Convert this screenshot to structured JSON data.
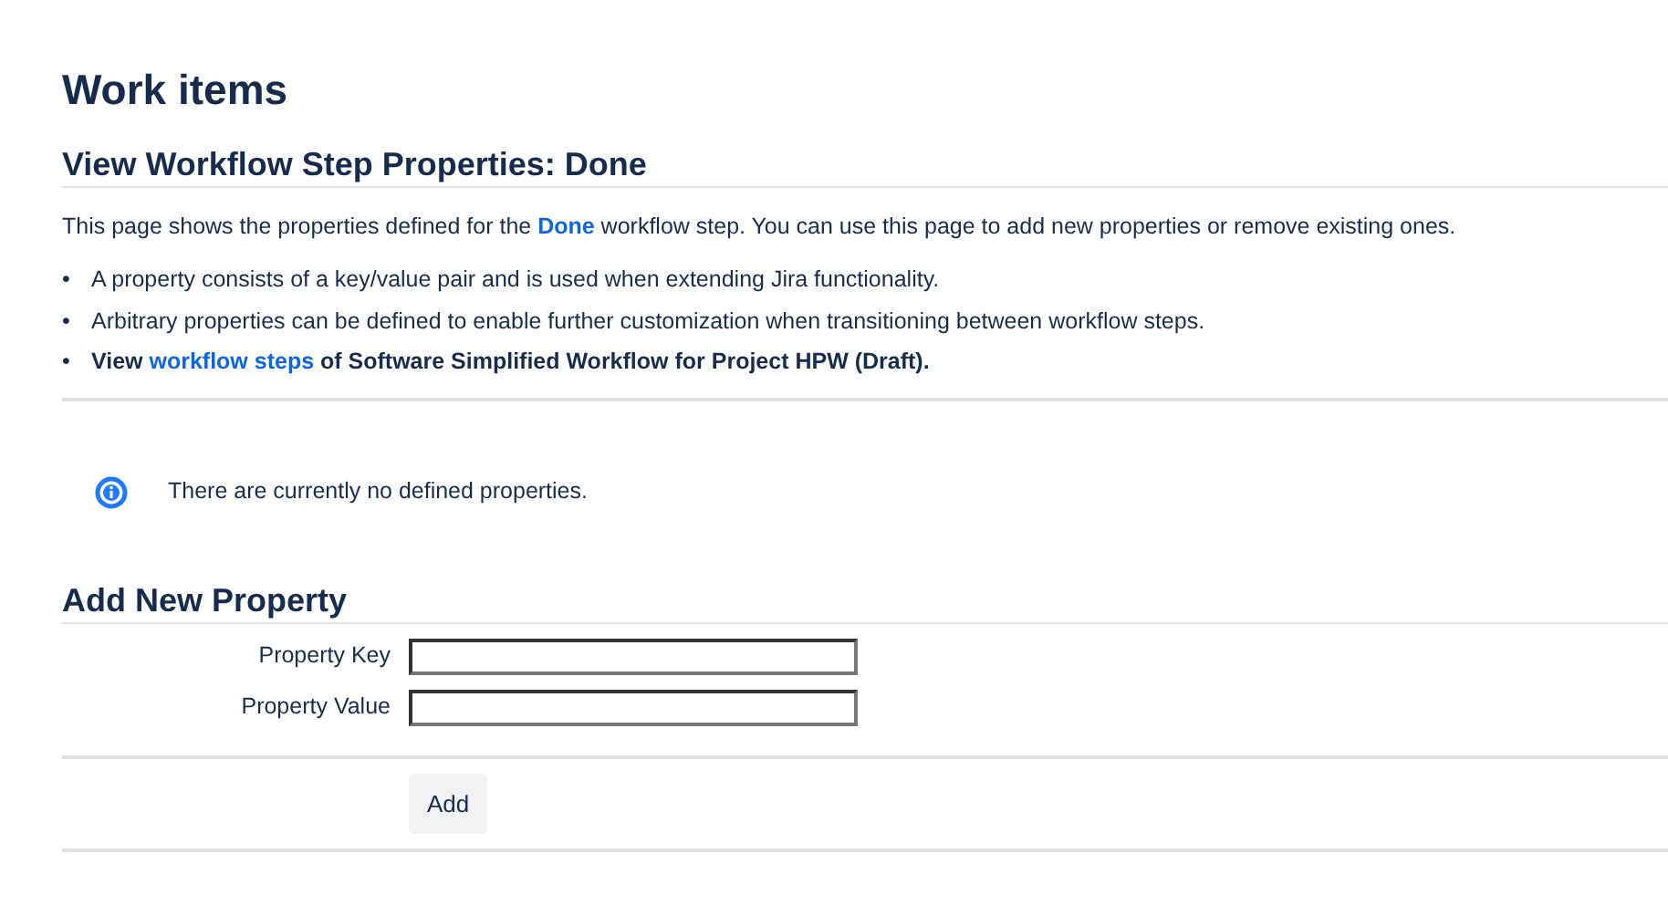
{
  "page_title": "Work items",
  "section_title": "View Workflow Step Properties: Done",
  "intro": {
    "before": "This page shows the properties defined for the ",
    "link": "Done",
    "after": " workflow step. You can use this page to add new properties or remove existing ones."
  },
  "bullets": [
    {
      "kind": "text",
      "marker": "•",
      "text": "A property consists of a key/value pair and is used when extending Jira functionality."
    },
    {
      "kind": "text",
      "marker": "•",
      "text": "Arbitrary properties can be defined to enable further customization when transitioning between workflow steps."
    },
    {
      "kind": "link",
      "marker": "•",
      "before": "View ",
      "link": "workflow steps",
      "after": " of Software Simplified Workflow for Project HPW (Draft)."
    }
  ],
  "info_message": "There are currently no defined properties.",
  "form": {
    "title": "Add New Property",
    "fields": [
      {
        "label": "Property Key"
      },
      {
        "label": "Property Value"
      }
    ],
    "submit": "Add"
  }
}
